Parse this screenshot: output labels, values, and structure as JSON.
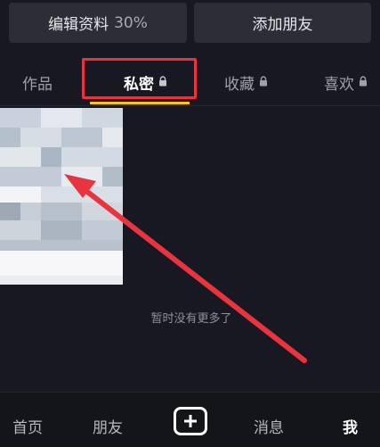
{
  "profile_actions": {
    "edit_profile_label": "编辑资料",
    "edit_profile_progress": "30%",
    "add_friends_label": "添加朋友"
  },
  "tabs": [
    {
      "label": "作品",
      "locked": false,
      "active": false
    },
    {
      "label": "私密",
      "locked": true,
      "active": true
    },
    {
      "label": "收藏",
      "locked": true,
      "active": false
    },
    {
      "label": "喜欢",
      "locked": true,
      "active": false
    }
  ],
  "content": {
    "empty_message": "暂时没有更多了"
  },
  "bottom_nav": {
    "home": "首页",
    "friends": "朋友",
    "create_icon": "plus-icon",
    "inbox": "消息",
    "me": "我"
  },
  "colors": {
    "background": "#171822",
    "tab_indicator": "#f5c518",
    "annotation_red": "#e8343f"
  }
}
